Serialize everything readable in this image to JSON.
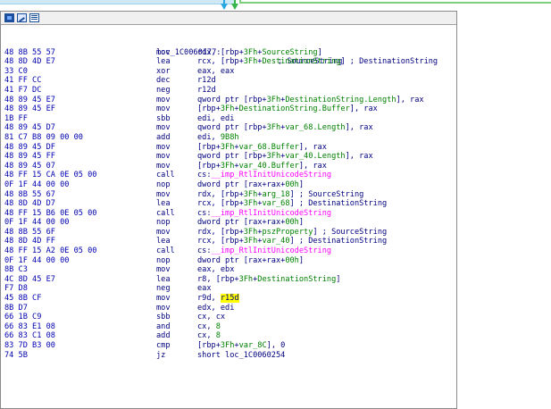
{
  "colors": {
    "operand": "#000080",
    "bytes": "#0000b0",
    "immediate": "#008000",
    "import": "#ff00ff",
    "highlight": "#ffff00"
  },
  "toolbar": {
    "icons": [
      "graph-color-icon",
      "edit-node-icon",
      "node-text-icon"
    ]
  },
  "block": {
    "label": "loc_1C0060177:",
    "label_comment": "; SourceString",
    "lines": [
      {
        "bytes": "48 8B 55 57",
        "mnem": "mov",
        "ops": [
          {
            "t": "rdx, [rbp+"
          },
          {
            "t": "3Fh",
            "c": "imm"
          },
          {
            "t": "+"
          },
          {
            "t": "SourceString",
            "c": "imm"
          },
          {
            "t": "]"
          }
        ]
      },
      {
        "bytes": "48 8D 4D E7",
        "mnem": "lea",
        "ops": [
          {
            "t": "rcx, [rbp+"
          },
          {
            "t": "3Fh",
            "c": "imm"
          },
          {
            "t": "+"
          },
          {
            "t": "DestinationString",
            "c": "imm"
          },
          {
            "t": "] ; DestinationString"
          }
        ]
      },
      {
        "bytes": "33 C0",
        "mnem": "xor",
        "ops": [
          {
            "t": "eax, eax"
          }
        ]
      },
      {
        "bytes": "41 FF CC",
        "mnem": "dec",
        "ops": [
          {
            "t": "r12d"
          }
        ]
      },
      {
        "bytes": "41 F7 DC",
        "mnem": "neg",
        "ops": [
          {
            "t": "r12d"
          }
        ]
      },
      {
        "bytes": "48 89 45 E7",
        "mnem": "mov",
        "ops": [
          {
            "t": "qword ptr [rbp+"
          },
          {
            "t": "3Fh",
            "c": "imm"
          },
          {
            "t": "+"
          },
          {
            "t": "DestinationString.Length",
            "c": "imm"
          },
          {
            "t": "], rax"
          }
        ]
      },
      {
        "bytes": "48 89 45 EF",
        "mnem": "mov",
        "ops": [
          {
            "t": "[rbp+"
          },
          {
            "t": "3Fh",
            "c": "imm"
          },
          {
            "t": "+"
          },
          {
            "t": "DestinationString.Buffer",
            "c": "imm"
          },
          {
            "t": "], rax"
          }
        ]
      },
      {
        "bytes": "1B FF",
        "mnem": "sbb",
        "ops": [
          {
            "t": "edi, edi"
          }
        ]
      },
      {
        "bytes": "48 89 45 D7",
        "mnem": "mov",
        "ops": [
          {
            "t": "qword ptr [rbp+"
          },
          {
            "t": "3Fh",
            "c": "imm"
          },
          {
            "t": "+"
          },
          {
            "t": "var_68.Length",
            "c": "imm"
          },
          {
            "t": "], rax"
          }
        ]
      },
      {
        "bytes": "81 C7 B8 09 00 00",
        "mnem": "add",
        "ops": [
          {
            "t": "edi, "
          },
          {
            "t": "9B8h",
            "c": "imm"
          }
        ]
      },
      {
        "bytes": "48 89 45 DF",
        "mnem": "mov",
        "ops": [
          {
            "t": "[rbp+"
          },
          {
            "t": "3Fh",
            "c": "imm"
          },
          {
            "t": "+"
          },
          {
            "t": "var_68.Buffer",
            "c": "imm"
          },
          {
            "t": "], rax"
          }
        ]
      },
      {
        "bytes": "48 89 45 FF",
        "mnem": "mov",
        "ops": [
          {
            "t": "qword ptr [rbp+"
          },
          {
            "t": "3Fh",
            "c": "imm"
          },
          {
            "t": "+"
          },
          {
            "t": "var_40.Length",
            "c": "imm"
          },
          {
            "t": "], rax"
          }
        ]
      },
      {
        "bytes": "48 89 45 07",
        "mnem": "mov",
        "ops": [
          {
            "t": "[rbp+"
          },
          {
            "t": "3Fh",
            "c": "imm"
          },
          {
            "t": "+"
          },
          {
            "t": "var_40.Buffer",
            "c": "imm"
          },
          {
            "t": "], rax"
          }
        ]
      },
      {
        "bytes": "48 FF 15 CA 0E 05 00",
        "mnem": "call",
        "ops": [
          {
            "t": "cs:"
          },
          {
            "t": "__imp_RtlInitUnicodeString",
            "c": "imp"
          }
        ]
      },
      {
        "bytes": "0F 1F 44 00 00",
        "mnem": "nop",
        "ops": [
          {
            "t": "dword ptr [rax+rax+"
          },
          {
            "t": "00h",
            "c": "imm"
          },
          {
            "t": "]"
          }
        ]
      },
      {
        "bytes": "48 8B 55 67",
        "mnem": "mov",
        "ops": [
          {
            "t": "rdx, [rbp+"
          },
          {
            "t": "3Fh",
            "c": "imm"
          },
          {
            "t": "+"
          },
          {
            "t": "arg_18",
            "c": "imm"
          },
          {
            "t": "] ; SourceString"
          }
        ]
      },
      {
        "bytes": "48 8D 4D D7",
        "mnem": "lea",
        "ops": [
          {
            "t": "rcx, [rbp+"
          },
          {
            "t": "3Fh",
            "c": "imm"
          },
          {
            "t": "+"
          },
          {
            "t": "var_68",
            "c": "imm"
          },
          {
            "t": "] ; DestinationString"
          }
        ]
      },
      {
        "bytes": "48 FF 15 B6 0E 05 00",
        "mnem": "call",
        "ops": [
          {
            "t": "cs:"
          },
          {
            "t": "__imp_RtlInitUnicodeString",
            "c": "imp"
          }
        ]
      },
      {
        "bytes": "0F 1F 44 00 00",
        "mnem": "nop",
        "ops": [
          {
            "t": "dword ptr [rax+rax+"
          },
          {
            "t": "00h",
            "c": "imm"
          },
          {
            "t": "]"
          }
        ]
      },
      {
        "bytes": "48 8B 55 6F",
        "mnem": "mov",
        "ops": [
          {
            "t": "rdx, [rbp+"
          },
          {
            "t": "3Fh",
            "c": "imm"
          },
          {
            "t": "+"
          },
          {
            "t": "pszProperty",
            "c": "imm"
          },
          {
            "t": "] ; SourceString"
          }
        ]
      },
      {
        "bytes": "48 8D 4D FF",
        "mnem": "lea",
        "ops": [
          {
            "t": "rcx, [rbp+"
          },
          {
            "t": "3Fh",
            "c": "imm"
          },
          {
            "t": "+"
          },
          {
            "t": "var_40",
            "c": "imm"
          },
          {
            "t": "] ; DestinationString"
          }
        ]
      },
      {
        "bytes": "48 FF 15 A2 0E 05 00",
        "mnem": "call",
        "ops": [
          {
            "t": "cs:"
          },
          {
            "t": "__imp_RtlInitUnicodeString",
            "c": "imp"
          }
        ]
      },
      {
        "bytes": "0F 1F 44 00 00",
        "mnem": "nop",
        "ops": [
          {
            "t": "dword ptr [rax+rax+"
          },
          {
            "t": "00h",
            "c": "imm"
          },
          {
            "t": "]"
          }
        ]
      },
      {
        "bytes": "8B C3",
        "mnem": "mov",
        "ops": [
          {
            "t": "eax, ebx"
          }
        ]
      },
      {
        "bytes": "4C 8D 45 E7",
        "mnem": "lea",
        "ops": [
          {
            "t": "r8, [rbp+"
          },
          {
            "t": "3Fh",
            "c": "imm"
          },
          {
            "t": "+"
          },
          {
            "t": "DestinationString",
            "c": "imm"
          },
          {
            "t": "]"
          }
        ]
      },
      {
        "bytes": "F7 D8",
        "mnem": "neg",
        "ops": [
          {
            "t": "eax"
          }
        ]
      },
      {
        "bytes": "45 8B CF",
        "mnem": "mov",
        "ops": [
          {
            "t": "r9d, "
          },
          {
            "t": "r15d",
            "c": "hl"
          }
        ]
      },
      {
        "bytes": "8B D7",
        "mnem": "mov",
        "ops": [
          {
            "t": "edx, edi"
          }
        ]
      },
      {
        "bytes": "66 1B C9",
        "mnem": "sbb",
        "ops": [
          {
            "t": "cx, cx"
          }
        ]
      },
      {
        "bytes": "66 83 E1 08",
        "mnem": "and",
        "ops": [
          {
            "t": "cx, "
          },
          {
            "t": "8",
            "c": "imm"
          }
        ]
      },
      {
        "bytes": "66 83 C1 08",
        "mnem": "add",
        "ops": [
          {
            "t": "cx, "
          },
          {
            "t": "8",
            "c": "imm"
          }
        ]
      },
      {
        "bytes": "83 7D B3 00",
        "mnem": "cmp",
        "ops": [
          {
            "t": "[rbp+"
          },
          {
            "t": "3Fh",
            "c": "imm"
          },
          {
            "t": "+"
          },
          {
            "t": "var_8C",
            "c": "imm"
          },
          {
            "t": "], 0"
          }
        ]
      },
      {
        "bytes": "74 5B",
        "mnem": "jz",
        "ops": [
          {
            "t": "short loc_1C0060254"
          }
        ]
      }
    ]
  }
}
